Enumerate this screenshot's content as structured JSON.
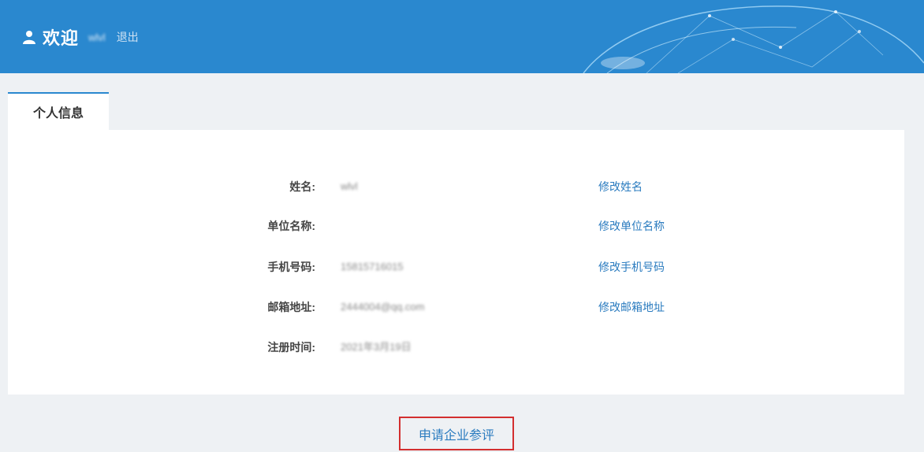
{
  "header": {
    "user_icon": "user-icon",
    "welcome": "欢迎",
    "username": "wlvl",
    "logout": "退出"
  },
  "tabs": [
    {
      "label": "个人信息",
      "active": true
    }
  ],
  "profile": {
    "rows": [
      {
        "label": "姓名:",
        "value": "wlvl",
        "edit": "修改姓名"
      },
      {
        "label": "单位名称:",
        "value": "",
        "edit": "修改单位名称"
      },
      {
        "label": "手机号码:",
        "value": "15815716015",
        "edit": "修改手机号码"
      },
      {
        "label": "邮箱地址:",
        "value": "2444004@qq.com",
        "edit": "修改邮箱地址"
      },
      {
        "label": "注册时间:",
        "value": "2021年3月19日",
        "edit": ""
      }
    ]
  },
  "apply_button": "申请企业参评",
  "colors": {
    "header_bg": "#2a88cf",
    "link": "#2a7bbf",
    "highlight_border": "#d32f2f",
    "page_bg": "#eef1f4"
  }
}
